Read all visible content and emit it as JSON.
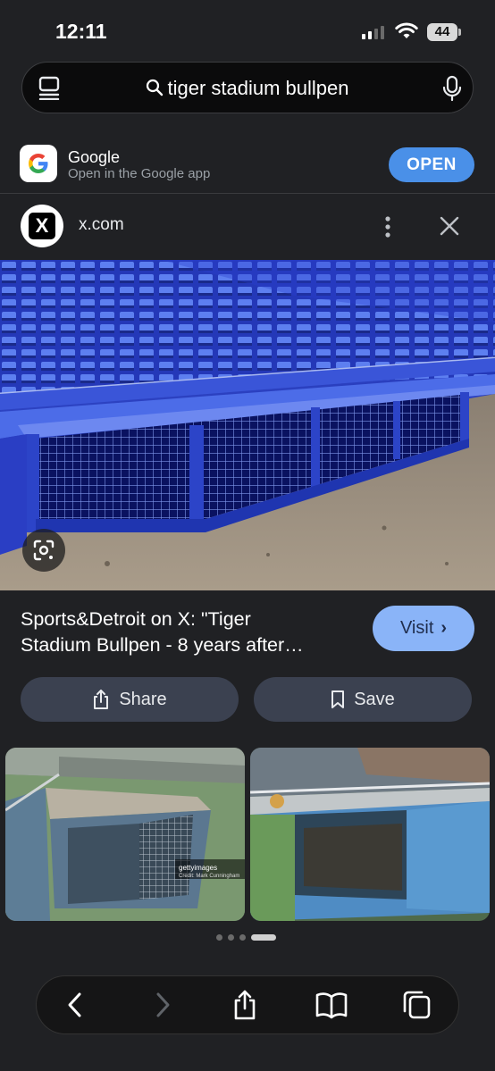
{
  "status_bar": {
    "time": "12:11",
    "battery": "44"
  },
  "search": {
    "query": "tiger stadium bullpen"
  },
  "app_banner": {
    "name": "Google",
    "subtitle": "Open in the Google app",
    "open_label": "OPEN"
  },
  "result": {
    "site": "x.com",
    "logo_letter": "X",
    "title_line1": "Sports&Detroit on X: \"Tiger",
    "title_line2": "Stadium Bullpen - 8 years after…",
    "visit_label": "Visit",
    "share_label": "Share",
    "save_label": "Save"
  },
  "related": {
    "watermark": "gettyimages",
    "credit": "Credit: Mark Cunningham",
    "dots_count": 4,
    "active_dot": 3
  },
  "colors": {
    "background": "#202124",
    "accent": "#8ab4f8",
    "open_button": "#4a90e8",
    "pill": "#3b4150"
  },
  "icons": {
    "tabs": "tabs-icon",
    "search": "search-icon",
    "mic": "mic-icon",
    "more": "more-vert-icon",
    "close": "close-icon",
    "lens": "lens-icon",
    "share": "share-icon",
    "bookmark": "bookmark-icon",
    "back": "back-icon",
    "forward": "forward-icon",
    "book": "bookmarks-icon",
    "tabs_toolbar": "tabs-overview-icon"
  }
}
